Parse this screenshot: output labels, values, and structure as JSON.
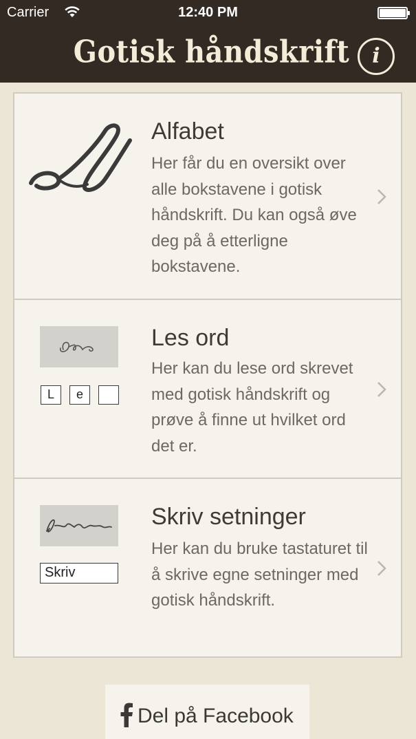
{
  "status_bar": {
    "carrier": "Carrier",
    "time": "12:40 PM"
  },
  "nav": {
    "title": "Gotisk håndskrift",
    "info_label": "i"
  },
  "menu": {
    "items": [
      {
        "title": "Alfabet",
        "description": "Her får du en oversikt over alle bokstavene i gotisk håndskrift. Du kan også øve deg på å etterligne bokstavene."
      },
      {
        "title": "Les ord",
        "description": "Her kan du lese ord skrevet med gotisk håndskrift og prøve å finne ut hvilket ord det er.",
        "letters": [
          "L",
          "e",
          ""
        ]
      },
      {
        "title": "Skriv setninger",
        "description": "Her kan du bruke tastaturet til å skrive egne setninger med gotisk håndskrift.",
        "field_text": "Skriv"
      }
    ]
  },
  "share": {
    "facebook_label": "Del på Facebook"
  },
  "colors": {
    "navbar": "#342a24",
    "title_text": "#f3ecd9",
    "background": "#ece6d6",
    "card": "#f6f3ec",
    "border": "#cfcbc1"
  },
  "icons": [
    "wifi-icon",
    "battery-icon",
    "info-icon",
    "chevron-right-icon",
    "facebook-icon"
  ]
}
